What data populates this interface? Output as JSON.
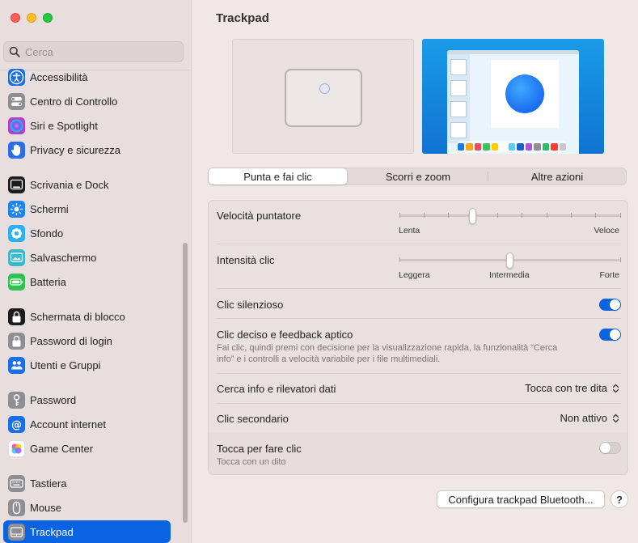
{
  "search": {
    "placeholder": "Cerca"
  },
  "sidebar": {
    "items": [
      {
        "label": "Accessibilità",
        "icon": "accessibility-icon",
        "color": "#1a6ee6"
      },
      {
        "label": "Centro di Controllo",
        "icon": "control-center-icon",
        "color": "#8e8e93"
      },
      {
        "label": "Siri e Spotlight",
        "icon": "siri-icon",
        "color": "#b43dd6"
      },
      {
        "label": "Privacy e sicurezza",
        "icon": "hand-icon",
        "color": "#2c6ce6"
      },
      {
        "label": "Scrivania e Dock",
        "icon": "desktop-dock-icon",
        "color": "#1c1c1e"
      },
      {
        "label": "Schermi",
        "icon": "displays-icon",
        "color": "#1a84f0"
      },
      {
        "label": "Sfondo",
        "icon": "wallpaper-icon",
        "color": "#2bb0f0"
      },
      {
        "label": "Salvaschermo",
        "icon": "screensaver-icon",
        "color": "#3ab8c8"
      },
      {
        "label": "Batteria",
        "icon": "battery-icon",
        "color": "#30c152"
      },
      {
        "label": "Schermata di blocco",
        "icon": "lock-screen-icon",
        "color": "#1c1c1e"
      },
      {
        "label": "Password di login",
        "icon": "lock-icon",
        "color": "#8e8e93"
      },
      {
        "label": "Utenti e Gruppi",
        "icon": "users-icon",
        "color": "#1a6ee6"
      },
      {
        "label": "Password",
        "icon": "key-icon",
        "color": "#8e8e93"
      },
      {
        "label": "Account internet",
        "icon": "at-icon",
        "color": "#1a6ee6"
      },
      {
        "label": "Game Center",
        "icon": "game-center-icon",
        "color": "#ffffff"
      },
      {
        "label": "Tastiera",
        "icon": "keyboard-icon",
        "color": "#8e8e93"
      },
      {
        "label": "Mouse",
        "icon": "mouse-icon",
        "color": "#8e8e93"
      },
      {
        "label": "Trackpad",
        "icon": "trackpad-icon",
        "color": "#8e8e93"
      }
    ]
  },
  "main": {
    "title": "Trackpad",
    "tabs": [
      "Punta e fai clic",
      "Scorri e zoom",
      "Altre azioni"
    ],
    "active_tab": "Punta e fai clic",
    "settings": {
      "tracking_speed": {
        "label": "Velocità puntatore",
        "min_label": "Lenta",
        "max_label": "Veloce",
        "level": 0.33
      },
      "click_pressure": {
        "label": "Intensità clic",
        "min_label": "Leggera",
        "mid_label": "Intermedia",
        "max_label": "Forte",
        "level": 0.5
      },
      "silent_click": {
        "label": "Clic silenzioso",
        "on": true
      },
      "force_click": {
        "label": "Clic deciso e feedback aptico",
        "desc_line1": "Fai clic, quindi premi con decisione per la visualizzazione rapida, la funzionalità “Cerca",
        "desc_line2": "info” e i controlli a velocità variabile per i file multimediali.",
        "on": true
      },
      "lookup": {
        "label": "Cerca info e rilevatori dati",
        "value": "Tocca con tre dita"
      },
      "secondary_click": {
        "label": "Clic secondario",
        "value": "Non attivo"
      },
      "tap_to_click": {
        "label": "Tocca per fare clic",
        "desc": "Tocca con un dito",
        "on": false
      }
    },
    "bluetooth_button": "Configura trackpad Bluetooth...",
    "help_button": "?"
  },
  "colors": {
    "accent": "#0a64e1"
  }
}
